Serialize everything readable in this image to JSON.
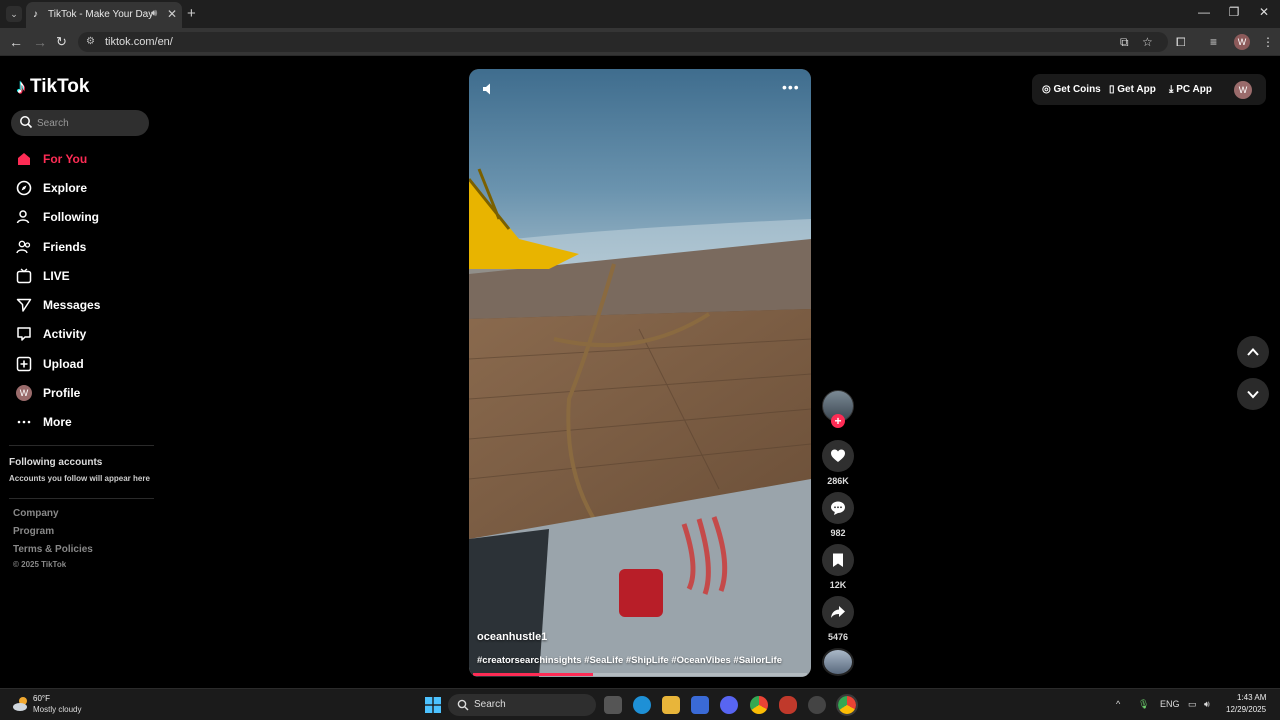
{
  "browser": {
    "tab_title": "TikTok - Make Your Day",
    "url": "tiktok.com/en/",
    "profile_initial": "W"
  },
  "sidebar": {
    "brand": "TikTok",
    "search_placeholder": "Search",
    "items": [
      {
        "label": "For You",
        "icon": "home-icon",
        "active": true
      },
      {
        "label": "Explore",
        "icon": "compass-icon"
      },
      {
        "label": "Following",
        "icon": "following-icon"
      },
      {
        "label": "Friends",
        "icon": "friends-icon"
      },
      {
        "label": "LIVE",
        "icon": "live-icon"
      },
      {
        "label": "Messages",
        "icon": "messages-icon"
      },
      {
        "label": "Activity",
        "icon": "activity-icon"
      },
      {
        "label": "Upload",
        "icon": "upload-icon"
      },
      {
        "label": "Profile",
        "icon": "avatar",
        "initial": "W"
      },
      {
        "label": "More",
        "icon": "more-icon"
      }
    ],
    "following_accounts_title": "Following accounts",
    "following_accounts_sub": "Accounts you follow will appear here",
    "footer_links": [
      "Company",
      "Program",
      "Terms & Policies"
    ],
    "copyright": "© 2025 TikTok"
  },
  "video": {
    "username": "oceanhustle1",
    "hashtags": "#creatorsearchinsights #SeaLife #ShipLife #OceanVibes #SailorLife",
    "progress_fraction": 0.36
  },
  "actions": {
    "likes": "286K",
    "comments": "982",
    "saves": "12K",
    "shares": "5476"
  },
  "topbar": {
    "get_coins": "Get Coins",
    "get_app": "Get App",
    "pc_app": "PC App",
    "avatar_initial": "W"
  },
  "taskbar": {
    "temperature": "60°F",
    "weather": "Mostly cloudy",
    "search_label": "Search",
    "language": "ENG",
    "time": "1:43 AM",
    "date": "12/29/2025"
  },
  "colors": {
    "accent": "#fe2c55",
    "background": "#000000"
  }
}
